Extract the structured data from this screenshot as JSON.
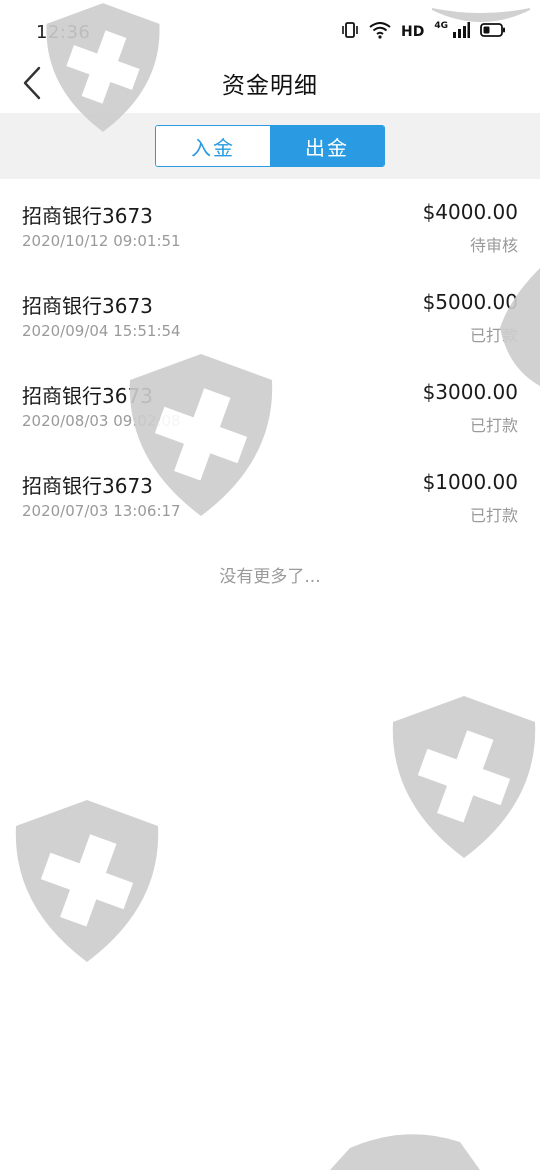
{
  "status_bar": {
    "time": "12:36",
    "hd": "HD",
    "network": "4G"
  },
  "header": {
    "title": "资金明细"
  },
  "tabs": [
    {
      "label": "入金",
      "active": false
    },
    {
      "label": "出金",
      "active": true
    }
  ],
  "records": [
    {
      "bank": "招商银行3673",
      "date": "2020/10/12 09:01:51",
      "amount": "$4000.00",
      "status": "待审核"
    },
    {
      "bank": "招商银行3673",
      "date": "2020/09/04 15:51:54",
      "amount": "$5000.00",
      "status": "已打款"
    },
    {
      "bank": "招商银行3673",
      "date": "2020/08/03 09:02:08",
      "amount": "$3000.00",
      "status": "已打款"
    },
    {
      "bank": "招商银行3673",
      "date": "2020/07/03 13:06:17",
      "amount": "$1000.00",
      "status": "已打款"
    }
  ],
  "footer": {
    "no_more": "没有更多了..."
  },
  "colors": {
    "accent": "#2a9be2",
    "tab_bar_bg": "#f1f1f1",
    "secondary_text": "#9a9a9a"
  }
}
